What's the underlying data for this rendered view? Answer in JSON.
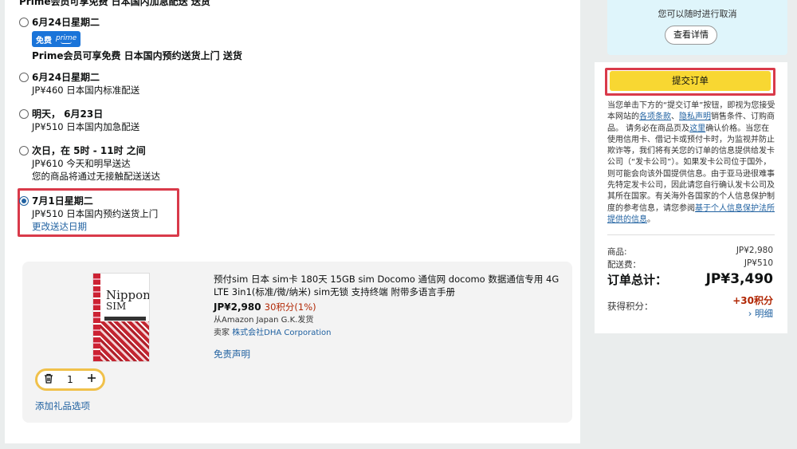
{
  "delivery": {
    "cut_top_text": "Prime会员可享免费 日本国内加急配送 送货",
    "options": [
      {
        "date": "6月24日星期二",
        "badge_text": "免费",
        "badge_logo": "prime",
        "desc": "Prime会员可享免费 日本国内预约送货上门 送货",
        "selected": false
      },
      {
        "date": "6月24日星期二",
        "price": "JP¥460 日本国内标准配送",
        "selected": false
      },
      {
        "date": "明天，  6月23日",
        "price": "JP¥510 日本国内加急配送",
        "selected": false
      },
      {
        "date": "次日，在 5时 - 11时 之间",
        "price": "JP¥610 今天和明早送达",
        "note": "您的商品将通过无接触配送送达",
        "selected": false
      },
      {
        "date": "7月1日星期二",
        "price": "JP¥510 日本国内预约送货上门",
        "link": "更改送达日期",
        "selected": true
      }
    ]
  },
  "product": {
    "image_brand_line1": "Nippon",
    "image_brand_line2": "SIM",
    "title": "预付sim 日本 sim卡 180天 15GB sim Docomo 通信网 docomo 数据通信专用 4G LTE 3in1(标准/微/纳米) sim无锁 支持终端 附带多语言手册",
    "price": "JP¥2,980",
    "points": "30积分(1%)",
    "shipped_from": "从Amazon Japan G.K.发货",
    "seller_label": "卖家",
    "seller_name": "株式会社DHA Corporation",
    "disclaimer": "免责声明",
    "quantity": "1",
    "gift_option": "添加礼品选项"
  },
  "sidebar": {
    "cancel_text": "您可以随时进行取消",
    "details_button": "查看详情",
    "place_order_button": "提交订单",
    "legal": {
      "p1": "当您单击下方的“提交订单”按钮，即视为您接受本网站的",
      "link_terms": "各项条款",
      "sep": "、",
      "link_privacy": "隐私声明",
      "p2": "销售条件、订购商品。 请务必在商品页及",
      "link_here": "这里",
      "p3": "确认价格。当您在使用信用卡、借记卡或预付卡时，为监视并防止欺诈等，我们将有关您的订单的信息提供给发卡公司（“发卡公司”）。如果发卡公司位于国外，则可能会向该外国提供信息。由于亚马逊很难事先特定发卡公司，因此请您自行确认发卡公司及其所在国家。有关海外各国家的个人信息保护制度的参考信息，请您参阅",
      "link_foreign": "基于个人信息保护法所提供的信息",
      "p4": "。"
    },
    "summary": {
      "items_label": "商品:",
      "items_value": "JP¥2,980",
      "shipping_label": "配送费：",
      "shipping_value": "JP¥510",
      "total_label": "订单总计：",
      "total_value": "JP¥3,490",
      "points_label": "获得积分：",
      "points_value": "+30积分",
      "points_link": "› 明细"
    }
  }
}
